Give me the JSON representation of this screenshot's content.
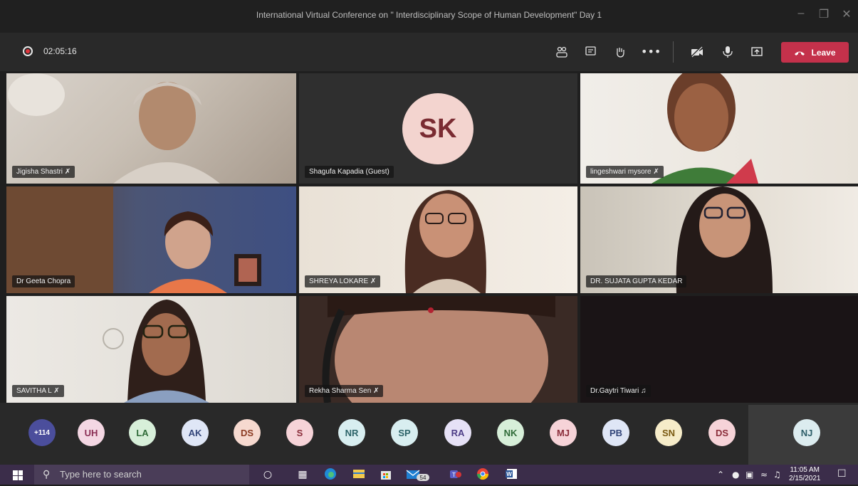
{
  "window": {
    "title": "International Virtual Conference on \" Interdisciplinary Scope of Human Development\" Day 1",
    "controls": [
      "minimize-icon",
      "maximize-icon",
      "close-icon"
    ]
  },
  "toolbar": {
    "timer": "02:05:16",
    "leave_label": "Leave",
    "icons": [
      "participants-icon",
      "chat-icon",
      "raise-hand-icon",
      "more-icon",
      "camera-off-icon",
      "mic-icon",
      "share-icon",
      "phone-icon"
    ]
  },
  "tiles": [
    {
      "name": "Jigisha Shastri",
      "muted": true
    },
    {
      "name": "Shagufa Kapadia (Guest)",
      "initials": "SK"
    },
    {
      "name": "lingeshwari mysore",
      "muted": true
    },
    {
      "name": "Dr Geeta Chopra"
    },
    {
      "name": "SHREYA LOKARE",
      "muted": true
    },
    {
      "name": "DR. SUJATA GUPTA KEDAR"
    },
    {
      "name": "SAVITHA L",
      "muted": true
    },
    {
      "name": "Rekha Sharma Sen",
      "muted": true
    },
    {
      "name": "Dr.Gaytri Tiwari",
      "muted": false
    }
  ],
  "participants": [
    {
      "label": "+114",
      "bg": "#4b4e9c",
      "fg": "#ffffff"
    },
    {
      "label": "UH",
      "bg": "#f4d7e3",
      "fg": "#8b2f55"
    },
    {
      "label": "LA",
      "bg": "#d7efd9",
      "fg": "#2f6b38"
    },
    {
      "label": "AK",
      "bg": "#dfe6f6",
      "fg": "#33467a"
    },
    {
      "label": "DS",
      "bg": "#f6d9cf",
      "fg": "#8b3b22"
    },
    {
      "label": "S",
      "bg": "#f6d3d8",
      "fg": "#8b2e3b"
    },
    {
      "label": "NR",
      "bg": "#d8eef0",
      "fg": "#2d6469"
    },
    {
      "label": "SP",
      "bg": "#d8eef0",
      "fg": "#2d6469"
    },
    {
      "label": "RA",
      "bg": "#e6e1f6",
      "fg": "#4d3d87"
    },
    {
      "label": "NK",
      "bg": "#d7efd9",
      "fg": "#2f6b38"
    },
    {
      "label": "MJ",
      "bg": "#f6d3d8",
      "fg": "#8b2e3b"
    },
    {
      "label": "PB",
      "bg": "#dfe6f6",
      "fg": "#33467a"
    },
    {
      "label": "SN",
      "bg": "#f6ecc9",
      "fg": "#7a5a12"
    },
    {
      "label": "DS",
      "bg": "#f6d3d8",
      "fg": "#8b2e3b"
    },
    {
      "label": "NJ",
      "bg": "#dcecef",
      "fg": "#2d5e69"
    }
  ],
  "taskbar": {
    "search_placeholder": "Type here to search",
    "mail_badge": "54",
    "time": "11:05 AM",
    "date": "2/15/2021"
  },
  "colors": {
    "leave": "#c4314b",
    "taskbar": "#3b2d4a",
    "toolbar": "#292929"
  }
}
